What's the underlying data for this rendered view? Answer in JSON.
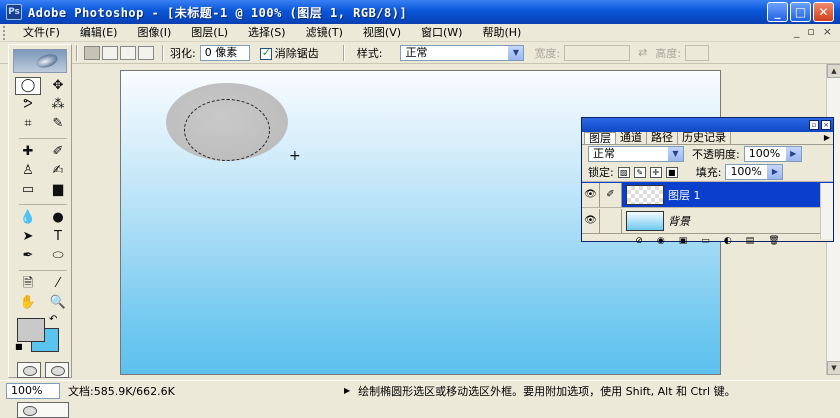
{
  "window": {
    "title": "Adobe Photoshop - [未标题-1 @ 100% (图层 1, RGB/8)]",
    "app_icon": "photoshop-icon",
    "controls": {
      "minimize": "_",
      "maximize": "□",
      "close": "✕"
    }
  },
  "menu": {
    "items": [
      "文件(F)",
      "编辑(E)",
      "图像(I)",
      "图层(L)",
      "选择(S)",
      "滤镜(T)",
      "视图(V)",
      "窗口(W)",
      "帮助(H)"
    ],
    "doc_controls": {
      "minimize": "_",
      "restore": "▫",
      "close": "×"
    }
  },
  "options": {
    "feather_label": "羽化:",
    "feather_value": "0 像素",
    "antialias_label": "消除锯齿",
    "antialias_checked": true,
    "style_label": "样式:",
    "style_value": "正常",
    "width_label": "宽度:",
    "height_label": "高度:",
    "swap_icon": "⇄"
  },
  "toolbox": {
    "tools": [
      {
        "name": "elliptical-marquee-tool",
        "glyph": "◯",
        "active": true
      },
      {
        "name": "move-tool",
        "glyph": "✥"
      },
      {
        "name": "lasso-tool",
        "glyph": "ᕗ"
      },
      {
        "name": "magic-wand-tool",
        "glyph": "⁂"
      },
      {
        "name": "crop-tool",
        "glyph": "⌗"
      },
      {
        "name": "slice-tool",
        "glyph": "✎"
      },
      {
        "name": "healing-brush-tool",
        "glyph": "✚"
      },
      {
        "name": "brush-tool",
        "glyph": "✐"
      },
      {
        "name": "clone-stamp-tool",
        "glyph": "♙"
      },
      {
        "name": "history-brush-tool",
        "glyph": "✍"
      },
      {
        "name": "eraser-tool",
        "glyph": "▭"
      },
      {
        "name": "gradient-tool",
        "glyph": "▆"
      },
      {
        "name": "blur-tool",
        "glyph": "💧"
      },
      {
        "name": "dodge-tool",
        "glyph": "●"
      },
      {
        "name": "path-selection-tool",
        "glyph": "➤"
      },
      {
        "name": "type-tool",
        "glyph": "T"
      },
      {
        "name": "pen-tool",
        "glyph": "✒"
      },
      {
        "name": "shape-tool",
        "glyph": "⬭"
      },
      {
        "name": "notes-tool",
        "glyph": "🗎"
      },
      {
        "name": "eyedropper-tool",
        "glyph": "⁄"
      },
      {
        "name": "hand-tool",
        "glyph": "✋"
      },
      {
        "name": "zoom-tool",
        "glyph": "🔍"
      }
    ],
    "foreground_color": "#c8c8c8",
    "background_color": "#5bc4ee"
  },
  "layers_panel": {
    "tabs": [
      "图层",
      "通道",
      "路径",
      "历史记录"
    ],
    "blend_mode": "正常",
    "opacity_label": "不透明度:",
    "opacity_value": "100%",
    "lock_label": "锁定:",
    "fill_label": "填充:",
    "fill_value": "100%",
    "layers": [
      {
        "name": "图层 1",
        "selected": true,
        "thumb": "transparent"
      },
      {
        "name": "背景",
        "selected": false,
        "thumb": "gradient",
        "locked": true
      }
    ]
  },
  "status": {
    "zoom": "100%",
    "doc_info": "文档:585.9K/662.6K",
    "hint": "绘制椭圆形选区或移动选区外框。要用附加选项，使用 Shift, Alt 和 Ctrl 键。"
  },
  "colors": {
    "titlebar": "#0a56d8",
    "chrome": "#ece9d8",
    "canvas_top": "#f9fcff",
    "canvas_bottom": "#5ec1ed",
    "selected_layer": "#0a3fce"
  }
}
